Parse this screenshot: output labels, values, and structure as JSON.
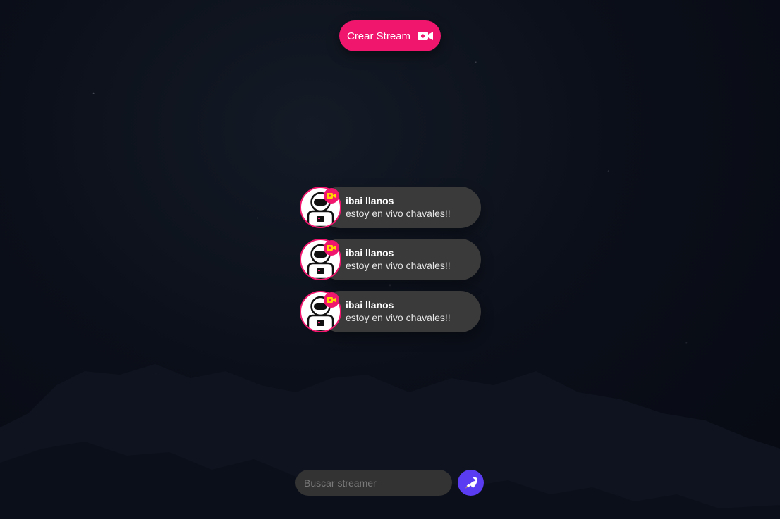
{
  "header": {
    "create_stream_label": "Crear Stream",
    "create_stream_icon": "video-camera-icon",
    "accent_color": "#f0166e"
  },
  "streams": [
    {
      "name": "ibai llanos",
      "status": "estoy en vivo chavales!!",
      "avatar_icon": "astronaut-icon",
      "badge_icon": "live-camera-icon"
    },
    {
      "name": "ibai llanos",
      "status": "estoy en vivo chavales!!",
      "avatar_icon": "astronaut-icon",
      "badge_icon": "live-camera-icon"
    },
    {
      "name": "ibai llanos",
      "status": "estoy en vivo chavales!!",
      "avatar_icon": "astronaut-icon",
      "badge_icon": "live-camera-icon"
    }
  ],
  "search": {
    "placeholder": "Buscar streamer",
    "value": "",
    "button_icon": "rocket-icon",
    "button_color": "#5a3cf2"
  }
}
